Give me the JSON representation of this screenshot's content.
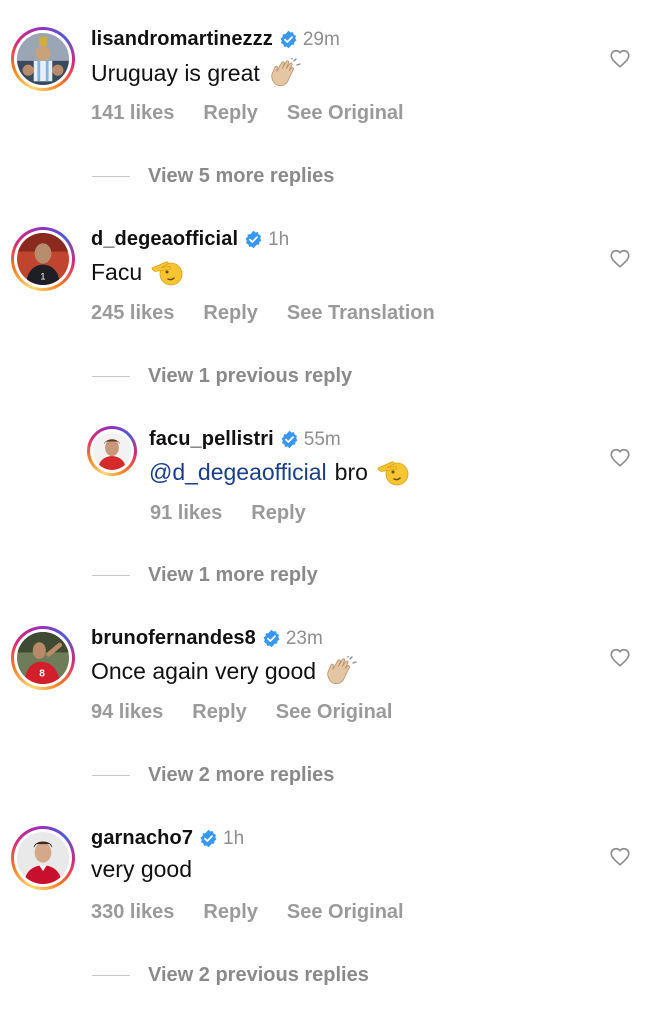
{
  "comments": [
    {
      "username": "lisandromartinezzz",
      "time": "29m",
      "text": "Uruguay is great",
      "emoji": "clapping-hands-emoji",
      "likes": "141 likes",
      "reply": "Reply",
      "action": "See Original",
      "view_replies": "View 5 more replies"
    },
    {
      "username": "d_degeaofficial",
      "time": "1h",
      "text": "Facu",
      "emoji": "saluting-face-emoji",
      "likes": "245 likes",
      "reply": "Reply",
      "action": "See Translation",
      "view_replies": "View 1 previous reply"
    },
    {
      "username": "facu_pellistri",
      "time": "55m",
      "mention": "@d_degeaofficial",
      "text": "bro",
      "emoji": "saluting-face-emoji",
      "likes": "91 likes",
      "reply": "Reply",
      "view_replies": "View 1 more reply"
    },
    {
      "username": "brunofernandes8",
      "time": "23m",
      "text": "Once again very good",
      "emoji": "clapping-hands-emoji",
      "likes": "94 likes",
      "reply": "Reply",
      "action": "See Original",
      "view_replies": "View 2 more replies"
    },
    {
      "username": "garnacho7",
      "time": "1h",
      "text": "very good",
      "likes": "330 likes",
      "reply": "Reply",
      "action": "See Original",
      "view_replies": "View 2 previous replies"
    }
  ],
  "colors": {
    "verified": "#3897f0",
    "mention": "#1a3e8b",
    "meta": "#9a9a9a"
  }
}
